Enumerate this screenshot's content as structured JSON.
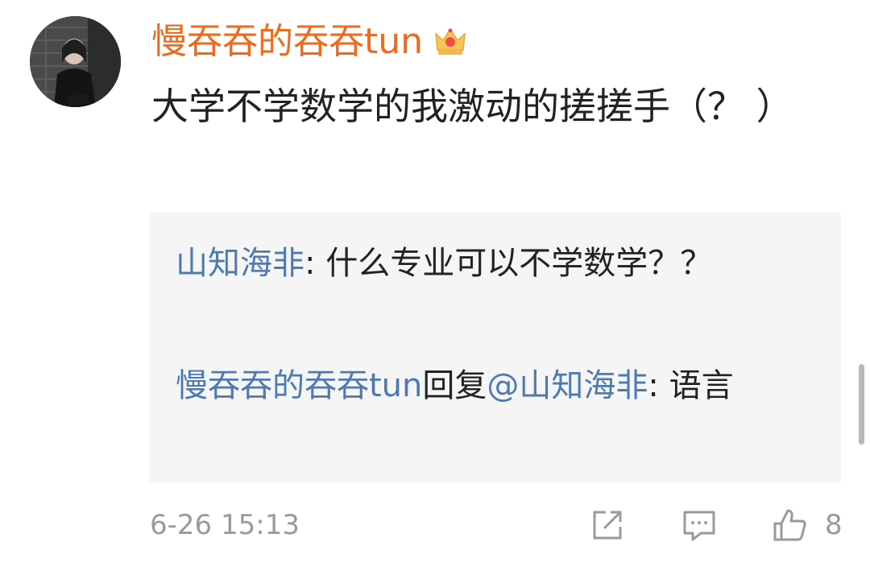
{
  "comment": {
    "author": "慢吞吞的吞吞tun",
    "badge_icon": "crown-badge-icon",
    "text": "大学不学数学的我激动的搓搓手（？ ）",
    "timestamp": "6-26 15:13",
    "like_count": "8",
    "colors": {
      "author": "#f06a1e",
      "link": "#4f7ab0",
      "meta": "#9a9a9a",
      "reply_bg": "#f5f5f5"
    }
  },
  "replies": [
    {
      "user": "山知海非",
      "separator": ": ",
      "text": "什么专业可以不学数学？？"
    },
    {
      "user": "慢吞吞的吞吞tun",
      "action": "回复",
      "mention": "@山知海非",
      "separator": ": ",
      "text": "语言"
    }
  ],
  "actions": [
    "repost-icon",
    "comment-icon",
    "like-icon"
  ]
}
